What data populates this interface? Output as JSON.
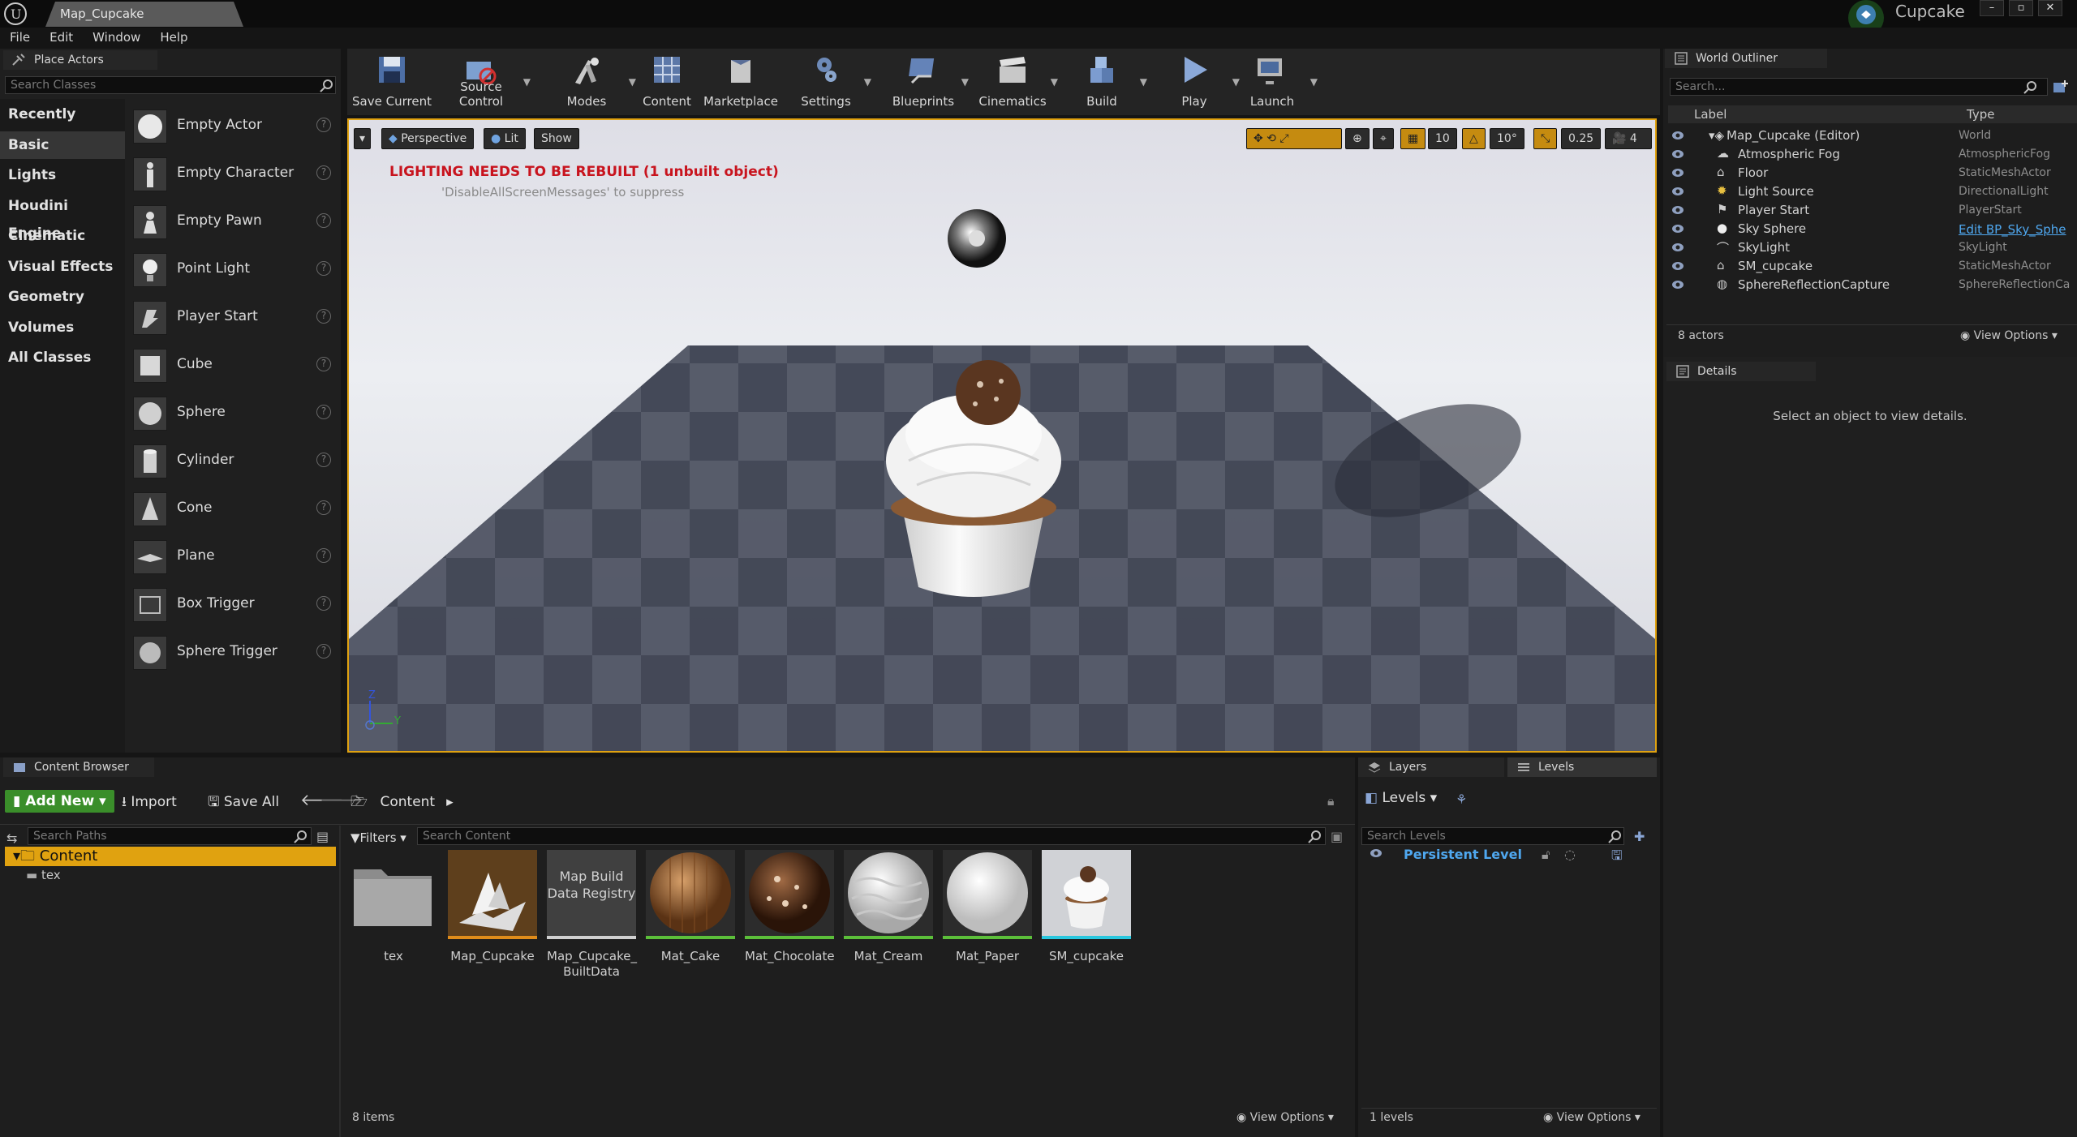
{
  "window": {
    "doc_tab": "Map_Cupcake",
    "project_name": "Cupcake",
    "buttons": [
      "–",
      "▫",
      "✕"
    ]
  },
  "menu": [
    "File",
    "Edit",
    "Window",
    "Help"
  ],
  "place_actors": {
    "tab": "Place Actors",
    "search_placeholder": "Search Classes",
    "categories": [
      "Recently Placed",
      "Basic",
      "Lights",
      "Houdini Engine",
      "Cinematic",
      "Visual Effects",
      "Geometry",
      "Volumes",
      "All Classes"
    ],
    "selected_category": "Basic",
    "actors": [
      "Empty Actor",
      "Empty Character",
      "Empty Pawn",
      "Point Light",
      "Player Start",
      "Cube",
      "Sphere",
      "Cylinder",
      "Cone",
      "Plane",
      "Box Trigger",
      "Sphere Trigger"
    ]
  },
  "toolbar": {
    "buttons": [
      "Save Current",
      "Source Control",
      "Modes",
      "Content",
      "Marketplace",
      "Settings",
      "Blueprints",
      "Cinematics",
      "Build",
      "Play",
      "Launch"
    ]
  },
  "viewport": {
    "perspective": "Perspective",
    "lit": "Lit",
    "show": "Show",
    "grid_snap": "10",
    "rot_snap": "10°",
    "scale_snap": "0.25",
    "cam_speed": "4",
    "warning": "LIGHTING NEEDS TO BE REBUILT (1 unbuilt object)",
    "warning_sub": "'DisableAllScreenMessages' to suppress",
    "axis_z": "Z",
    "axis_y": "Y"
  },
  "world_outliner": {
    "tab": "World Outliner",
    "search_placeholder": "Search...",
    "col_label": "Label",
    "col_type": "Type",
    "rows": [
      {
        "label": "Map_Cupcake (Editor)",
        "type": "World"
      },
      {
        "label": "Atmospheric Fog",
        "type": "AtmosphericFog"
      },
      {
        "label": "Floor",
        "type": "StaticMeshActor"
      },
      {
        "label": "Light Source",
        "type": "DirectionalLight"
      },
      {
        "label": "Player Start",
        "type": "PlayerStart"
      },
      {
        "label": "Sky Sphere",
        "type": "Edit BP_Sky_Sphe"
      },
      {
        "label": "SkyLight",
        "type": "SkyLight"
      },
      {
        "label": "SM_cupcake",
        "type": "StaticMeshActor"
      },
      {
        "label": "SphereReflectionCapture",
        "type": "SphereReflectionCa"
      }
    ],
    "count": "8 actors",
    "view_options": "View Options"
  },
  "details": {
    "tab": "Details",
    "empty_msg": "Select an object to view details."
  },
  "content_browser": {
    "tab": "Content Browser",
    "add_new": "Add New",
    "import": "Import",
    "save_all": "Save All",
    "path": "Content",
    "search_paths": "Search Paths",
    "filters": "Filters",
    "search_content": "Search Content",
    "tree": [
      "Content",
      "tex"
    ],
    "assets": [
      {
        "name": "tex",
        "kind": "folder"
      },
      {
        "name": "Map_Cupcake",
        "kind": "map"
      },
      {
        "name": "Map_Cupcake_ BuiltData",
        "kind": "registry",
        "tile_text": "Map Build Data Registry"
      },
      {
        "name": "Mat_Cake",
        "kind": "material"
      },
      {
        "name": "Mat_Chocolate",
        "kind": "material"
      },
      {
        "name": "Mat_Cream",
        "kind": "material"
      },
      {
        "name": "Mat_Paper",
        "kind": "material"
      },
      {
        "name": "SM_cupcake",
        "kind": "mesh"
      }
    ],
    "count": "8 items",
    "view_options": "View Options"
  },
  "levels": {
    "tab_layers": "Layers",
    "tab_levels": "Levels",
    "levels_btn": "Levels",
    "search_placeholder": "Search Levels",
    "persistent": "Persistent Level",
    "count": "1 levels",
    "view_options": "View Options"
  },
  "colors": {
    "accent": "#e0a210",
    "add_new": "#3a8e2a",
    "link": "#4fa8f0",
    "warning": "#c8141e"
  }
}
